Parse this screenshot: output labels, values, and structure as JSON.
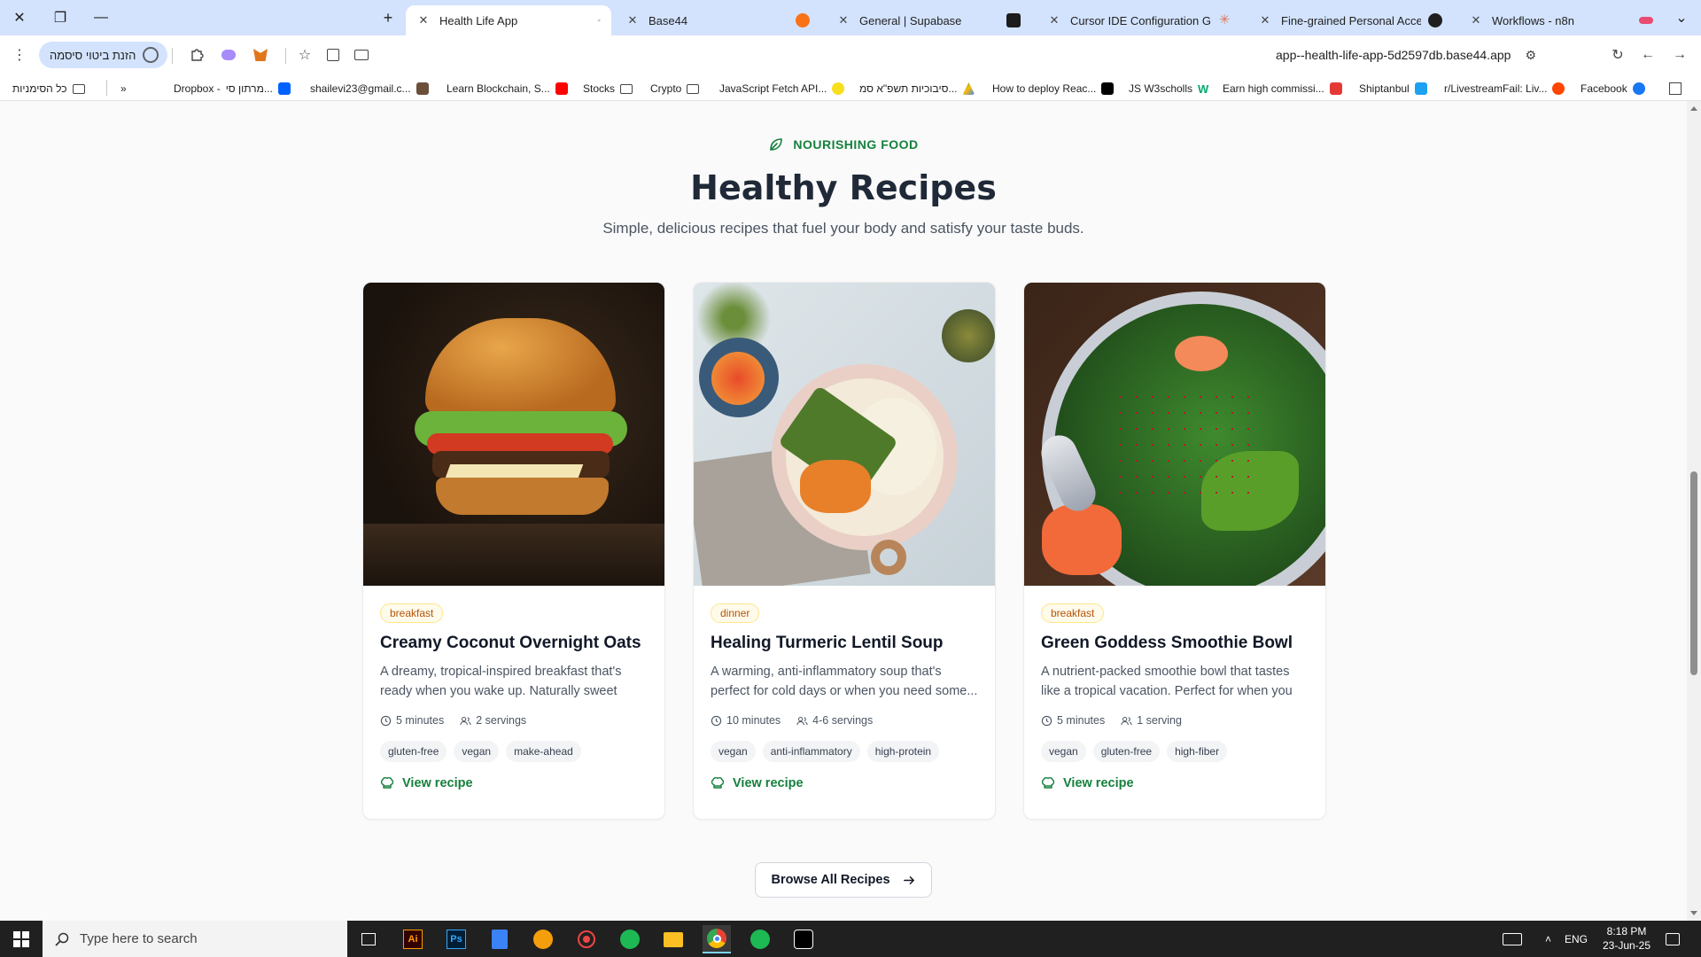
{
  "browser": {
    "tabs": [
      {
        "title": "Health Life App",
        "active": true
      },
      {
        "title": "Base44",
        "active": false
      },
      {
        "title": "General | Supabase",
        "active": false
      },
      {
        "title": "Cursor IDE Configuration Guide",
        "active": false
      },
      {
        "title": "Fine-grained Personal Access To",
        "active": false
      },
      {
        "title": "Workflows - n8n",
        "active": false
      }
    ],
    "password_chip": "הזנת ביטוי סיסמה",
    "url": "app--health-life-app-5d2597db.base44.app",
    "bookmarks": [
      "כל הסימניות",
      "מרתון סי...",
      "Dropbox -",
      "shailevi23@gmail.c...",
      "Learn Blockchain, S...",
      "Stocks",
      "Crypto",
      "JavaScript Fetch API...",
      "סיבוכיות תשפ\"א סמ...",
      "How to deploy Reac...",
      "JS W3scholls",
      "Earn high commissi...",
      "Shiptanbul",
      "r/LivestreamFail: Liv...",
      "Facebook"
    ]
  },
  "section": {
    "eyebrow": "NOURISHING FOOD",
    "title": "Healthy Recipes",
    "subtitle": "Simple, delicious recipes that fuel your body and satisfy your taste buds."
  },
  "recipes": [
    {
      "category": "breakfast",
      "title": "Creamy Coconut Overnight Oats",
      "description": "A dreamy, tropical-inspired breakfast that's ready when you wake up. Naturally sweet and...",
      "time": "5 minutes",
      "servings": "2 servings",
      "tags": [
        "gluten-free",
        "vegan",
        "make-ahead"
      ],
      "link": "View recipe",
      "image": "burger-photo"
    },
    {
      "category": "dinner",
      "title": "Healing Turmeric Lentil Soup",
      "description": "A warming, anti-inflammatory soup that's perfect for cold days or when you need some...",
      "time": "10 minutes",
      "servings": "4-6 servings",
      "tags": [
        "vegan",
        "anti-inflammatory",
        "high-protein"
      ],
      "link": "View recipe",
      "image": "grain-bowl-photo"
    },
    {
      "category": "breakfast",
      "title": "Green Goddess Smoothie Bowl",
      "description": "A nutrient-packed smoothie bowl that tastes like a tropical vacation. Perfect for when you want...",
      "time": "5 minutes",
      "servings": "1 serving",
      "tags": [
        "vegan",
        "gluten-free",
        "high-fiber"
      ],
      "link": "View recipe",
      "image": "salad-photo"
    }
  ],
  "browse_button": "Browse All Recipes",
  "taskbar": {
    "search_placeholder": "Type here to search",
    "language": "ENG",
    "time": "8:18 PM",
    "date": "23-Jun-25"
  },
  "colors": {
    "accent_green": "#15803d",
    "badge_amber": "#b45309",
    "tab_strip": "#d3e3fd"
  }
}
